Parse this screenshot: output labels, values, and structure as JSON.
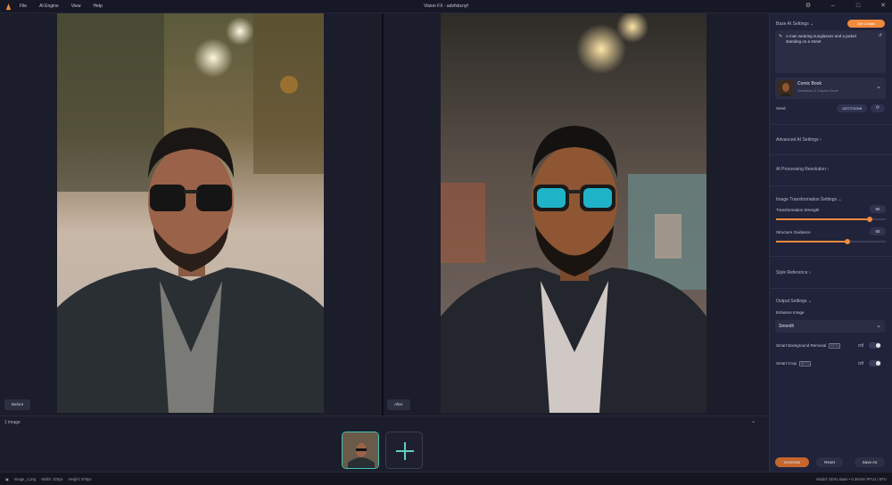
{
  "titlebar": {
    "menu": [
      "File",
      "AI Engine",
      "View",
      "Help"
    ],
    "title": "Vision FX - advfxbcnyf"
  },
  "canvas": {
    "before_label": "Before",
    "after_label": "After"
  },
  "strip": {
    "count": "1 image"
  },
  "statusbar": {
    "file": "image_1.png",
    "width": "Width: 320px",
    "height": "Height: 576px",
    "right": "Model: SDXL  Base • 0.35/min PFU1  |  EFU"
  },
  "panel": {
    "base_title": "Base AI Settings",
    "get_credits": "Get Credits",
    "prompt": "A man wearing sunglasses and a jacket standing on a street",
    "style_name": "Comic Book",
    "style_desc": "Illustration & Graphic Novel",
    "seed_label": "Seed",
    "seed_value": "1527276348",
    "advanced": "Advanced AI Settings",
    "resolution": "AI Processing Resolution",
    "transform_title": "Image Transformation Settings",
    "strength_label": "Transformation Strength",
    "strength_value": "85",
    "strength_pct": 0.85,
    "guidance_label": "Structure Guidance",
    "guidance_value": "65",
    "guidance_pct": 0.65,
    "style_ref": "Style Reference",
    "output_title": "Output Settings",
    "enhance_label": "Enhance Image",
    "enhance_value": "Smooth",
    "bg_removal": "Smart Background Removal",
    "bg_tag": "BETA",
    "bg_state": "Off",
    "crop": "Smart Crop",
    "crop_tag": "BETA",
    "crop_state": "Off",
    "generate": "Generate",
    "reset": "Reset",
    "save": "Save As"
  },
  "colors": {
    "accent": "#f08a3c",
    "panel": "#20233a",
    "bg": "#1b1d2a"
  }
}
